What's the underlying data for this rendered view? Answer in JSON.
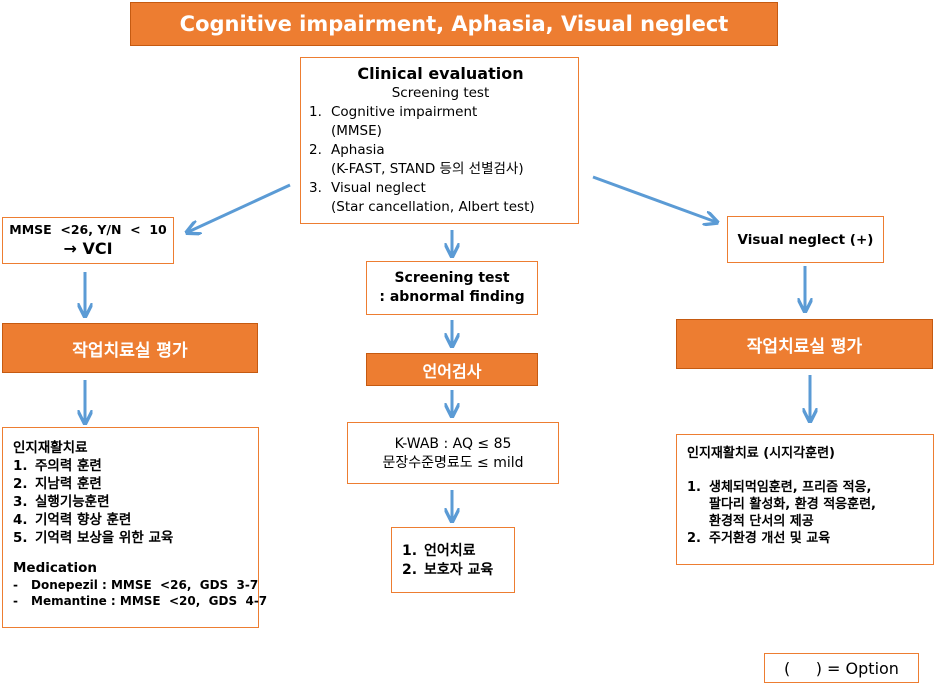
{
  "title": "Cognitive impairment, Aphasia, Visual neglect",
  "clinical_evaluation": {
    "heading": "Clinical evaluation",
    "subheading": "Screening test",
    "items": [
      {
        "num": "1.",
        "label": "Cognitive impairment",
        "detail": "(MMSE)"
      },
      {
        "num": "2.",
        "label": "Aphasia",
        "detail": "(K-FAST, STAND 등의 선별검사)"
      },
      {
        "num": "3.",
        "label": "Visual neglect",
        "detail": "(Star cancellation, Albert test)"
      }
    ]
  },
  "left_branch": {
    "criteria_line1": "MMSE  <26, Y/N  <  10",
    "criteria_line2": "→ VCI",
    "eval_label": "작업치료실 평가",
    "therapy": {
      "heading": "인지재활치료",
      "items": [
        {
          "num": "1.",
          "label": "주의력 훈련"
        },
        {
          "num": "2.",
          "label": "지남력 훈련"
        },
        {
          "num": "3.",
          "label": "실행기능훈련"
        },
        {
          "num": "4.",
          "label": "기억력 향상 훈련"
        },
        {
          "num": "5.",
          "label": "기억력 보상을 위한 교육"
        }
      ],
      "medication_heading": "Medication",
      "medications": [
        {
          "dash": "-",
          "label": "Donepezil : MMSE  <26,  GDS  3-7"
        },
        {
          "dash": "-",
          "label": "Memantine : MMSE  <20,  GDS  4-7"
        }
      ]
    }
  },
  "center_branch": {
    "screening_line1": "Screening test",
    "screening_line2": ": abnormal finding",
    "language_test_label": "언어검사",
    "kwab_line1": "K-WAB : AQ ≤ 85",
    "kwab_line2": "문장수준명료도 ≤ mild",
    "treatment": [
      {
        "num": "1.",
        "label": "언어치료"
      },
      {
        "num": "2.",
        "label": "보호자 교육"
      }
    ]
  },
  "right_branch": {
    "criteria": "Visual neglect (+)",
    "eval_label": "작업치료실 평가",
    "therapy": {
      "heading": "인지재활치료 (시지각훈련)",
      "items": [
        {
          "num": "1.",
          "lines": [
            "생체되먹임훈련, 프리즘 적응,",
            "팔다리 활성화, 환경 적응훈련,",
            "환경적 단서의 제공"
          ]
        },
        {
          "num": "2.",
          "lines": [
            "주거환경 개선 및 교육"
          ]
        }
      ]
    }
  },
  "legend": "(     ) = Option",
  "colors": {
    "orange_fill": "#ED7D31",
    "orange_border": "#C55A11",
    "arrow_blue": "#5B9BD5"
  }
}
